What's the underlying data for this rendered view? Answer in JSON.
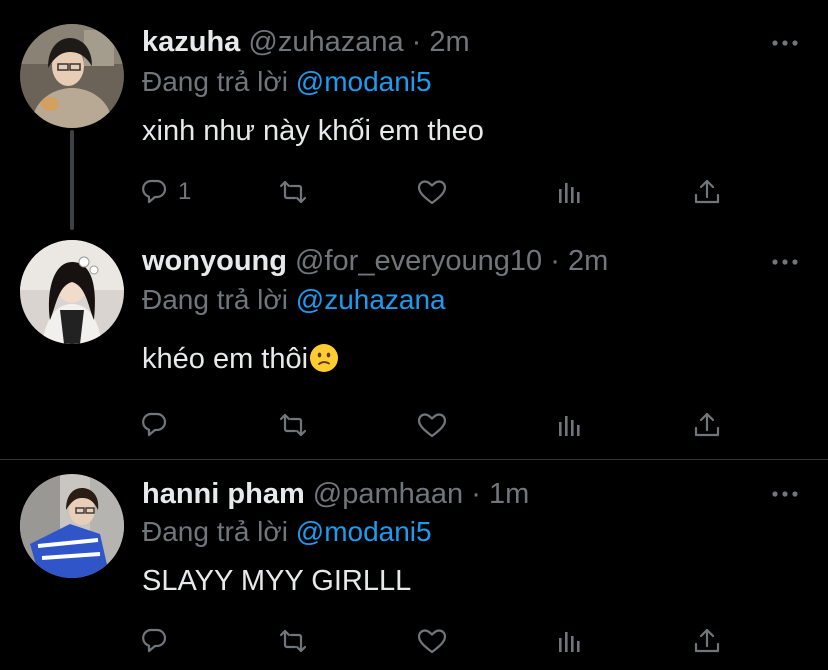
{
  "colors": {
    "background": "#000000",
    "text": "#e7e9ea",
    "muted": "#71767b",
    "link": "#1d9bf0",
    "divider": "#2f3336"
  },
  "tweets": [
    {
      "name": "kazuha",
      "handle": "@zuhazana",
      "separator": "·",
      "time": "2m",
      "replying_prefix": "Đang trả lời",
      "replying_to": "@modani5",
      "text": "xinh như này khối em theo",
      "reply_count": "1",
      "avatar_icon": "avatar-photo"
    },
    {
      "name": "wonyoung",
      "handle": "@for_everyoung10",
      "separator": "·",
      "time": "2m",
      "replying_prefix": "Đang trả lời",
      "replying_to": "@zuhazana",
      "text": "khéo em thôi",
      "emoji": "confused-face-emoji",
      "reply_count": "",
      "avatar_icon": "avatar-photo"
    },
    {
      "name": "hanni pham",
      "handle": "@pamhaan",
      "separator": "·",
      "time": "1m",
      "replying_prefix": "Đang trả lời",
      "replying_to": "@modani5",
      "text": "SLAYY MYY GIRLLL",
      "reply_count": "",
      "avatar_icon": "avatar-photo"
    }
  ],
  "action_icons": [
    "reply-icon",
    "retweet-icon",
    "like-icon",
    "analytics-icon",
    "share-icon"
  ]
}
